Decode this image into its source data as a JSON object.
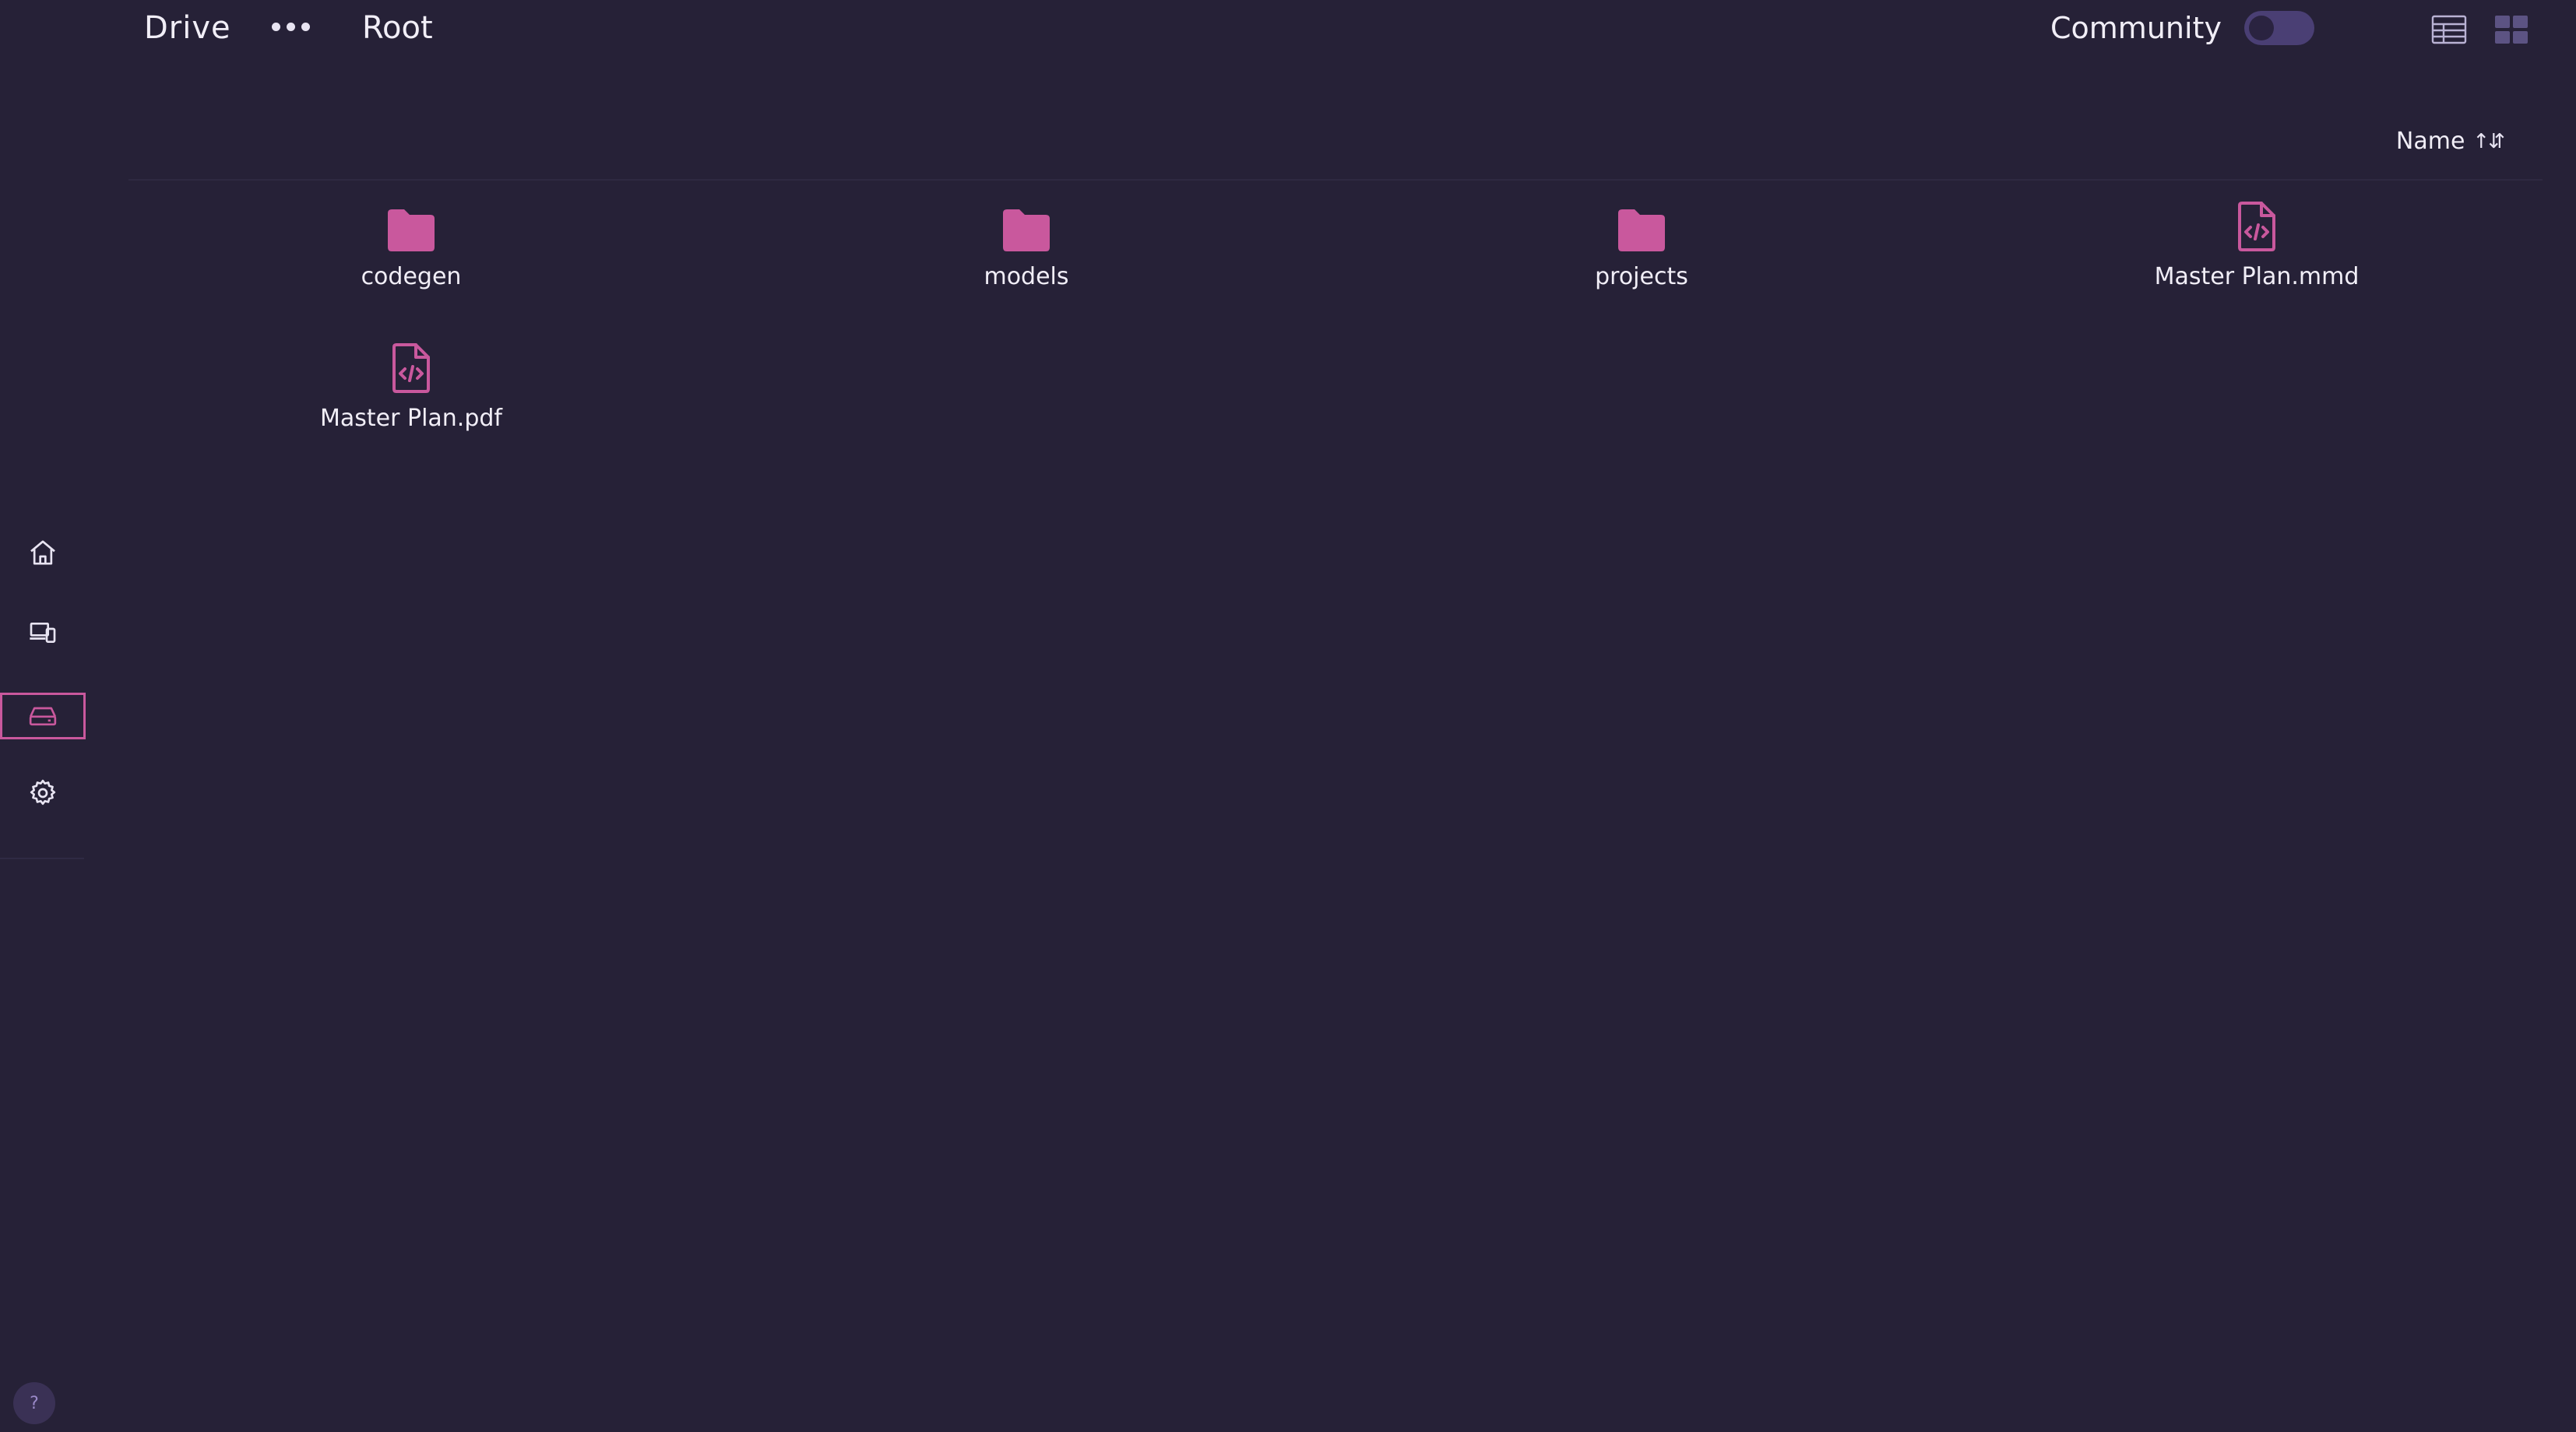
{
  "header": {
    "breadcrumb": {
      "drive": "Drive",
      "root": "Root"
    },
    "community_label": "Community",
    "community_enabled": false
  },
  "sort": {
    "label": "Name",
    "icon": "sort-ascending-icon"
  },
  "items": [
    {
      "name": "codegen",
      "type": "folder"
    },
    {
      "name": "models",
      "type": "folder"
    },
    {
      "name": "projects",
      "type": "folder"
    },
    {
      "name": "Master Plan.mmd",
      "type": "code-file"
    },
    {
      "name": "Master Plan.pdf",
      "type": "code-file"
    }
  ],
  "sidebar": {
    "items": [
      {
        "id": "home",
        "icon": "home-icon"
      },
      {
        "id": "devices",
        "icon": "devices-icon"
      },
      {
        "id": "drive",
        "icon": "hard-drive-icon",
        "active": true
      },
      {
        "id": "settings",
        "icon": "gear-icon"
      }
    ],
    "help_label": "?"
  },
  "colors": {
    "background": "#262137",
    "accent": "#c9589d",
    "text": "#f1eef7",
    "toggle_track": "#4a3f74"
  }
}
